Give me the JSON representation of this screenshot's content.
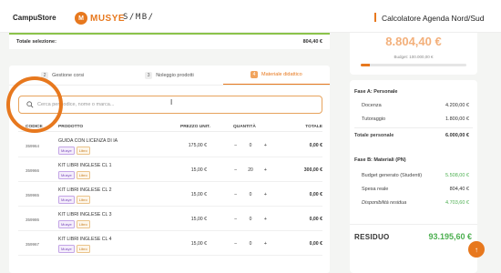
{
  "header": {
    "brand_campus": "CampuStore",
    "brand_musye": "MUSYE",
    "brand_musye_mark": "M",
    "brand_smbi": "S/MB/",
    "title": "Calcolatore Agenda Nord/Sud"
  },
  "selection": {
    "label": "Totale selezione:",
    "value": "804,40 €"
  },
  "tabs": [
    {
      "num": "2",
      "label": "Gestione corsi",
      "active": false
    },
    {
      "num": "3",
      "label": "Noleggio prodotti",
      "active": false
    },
    {
      "num": "4",
      "label": "Materiale didattico",
      "active": true
    }
  ],
  "search": {
    "placeholder": "Cerca per codice, nome o marca...",
    "icon": "search-icon"
  },
  "table": {
    "headers": {
      "code": "CODICE",
      "product": "PRODOTTO",
      "price": "PREZZO UNIT.",
      "qty": "QUANTITÀ",
      "total": "TOTALE"
    },
    "rows": [
      {
        "code": "359964",
        "name": "GUIDA CON LICENZA DI IA",
        "badge1": "Musye",
        "badge2": "Libro",
        "price": "175,00 €",
        "qty": "0",
        "total": "0,00 €"
      },
      {
        "code": "359966",
        "name": "KIT LIBRI INGLESE CL 1",
        "badge1": "Musye",
        "badge2": "Libro",
        "price": "15,00 €",
        "qty": "20",
        "total": "300,00 €"
      },
      {
        "code": "359965",
        "name": "KIT LIBRI INGLESE CL 2",
        "badge1": "Musye",
        "badge2": "Libro",
        "price": "15,00 €",
        "qty": "0",
        "total": "0,00 €"
      },
      {
        "code": "359986",
        "name": "KIT LIBRI INGLESE CL 3",
        "badge1": "Musye",
        "badge2": "Libro",
        "price": "15,00 €",
        "qty": "0",
        "total": "0,00 €"
      },
      {
        "code": "359967",
        "name": "KIT LIBRI INGLESE CL 4",
        "badge1": "Musye",
        "badge2": "Libro",
        "price": "15,00 €",
        "qty": "0",
        "total": "0,00 €"
      }
    ],
    "minus": "−",
    "plus": "+"
  },
  "sidebar": {
    "big_figure": "8.804,40 €",
    "budget_label": "Budget: 100.000,00 €",
    "progress_fraction": 0.088,
    "phase_a": "Fase A: Personale",
    "docenza_label": "Docenza",
    "docenza_value": "4.200,00 €",
    "tutoraggio_label": "Tutoraggio",
    "tutoraggio_value": "1.800,00 €",
    "totale_personale_label": "Totale personale",
    "totale_personale_value": "6.000,00 €",
    "phase_b": "Fase B: Materiali (PN)",
    "budget_gen_label": "Budget generato (Studenti)",
    "budget_gen_value": "5.508,00 €",
    "spesa_label": "Spesa reale",
    "spesa_value": "804,40 €",
    "disp_label": "Disponibilità residua",
    "disp_value": "4.703,60 €",
    "residuo_label": "RESIDUO",
    "residuo_value": "93.195,60 €"
  },
  "fab_icon": "arrow-up-icon",
  "fab_glyph": "↑",
  "colors": {
    "accent": "#e7781e",
    "green": "#4caf50",
    "musye_purple": "#7c4dbd"
  }
}
